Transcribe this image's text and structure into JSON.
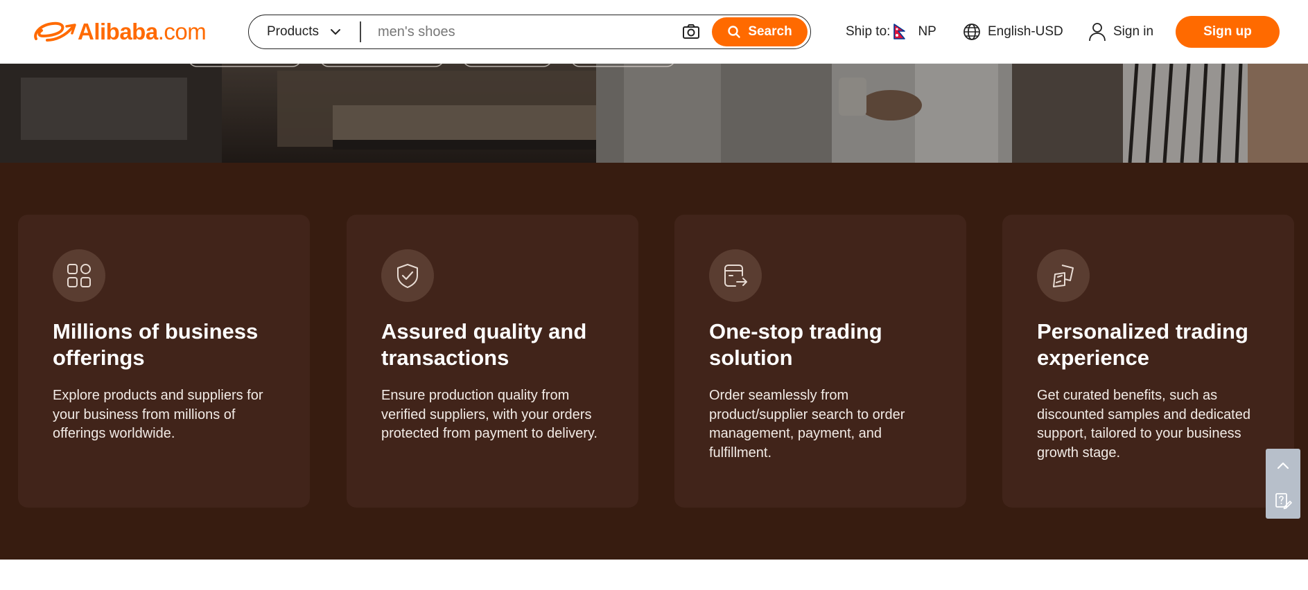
{
  "header": {
    "logo_brand": "Alibaba",
    "logo_suffix": ".com",
    "search": {
      "category": "Products",
      "placeholder": "men's shoes",
      "value": "",
      "button_label": "Search"
    },
    "ship_to": {
      "label": "Ship to:",
      "country": "NP"
    },
    "language": "English-USD",
    "sign_in": "Sign in",
    "sign_up": "Sign up"
  },
  "features": [
    {
      "icon": "grid-apps-icon",
      "title": "Millions of business offerings",
      "description": "Explore products and suppliers for your business from millions of offerings worldwide."
    },
    {
      "icon": "shield-check-icon",
      "title": "Assured quality and transactions",
      "description": "Ensure production quality from verified suppliers, with your orders protected from payment to delivery."
    },
    {
      "icon": "order-transfer-icon",
      "title": "One-stop trading solution",
      "description": "Order seamlessly from product/supplier search to order management, payment, and fulfillment."
    },
    {
      "icon": "personalized-cubes-icon",
      "title": "Personalized trading experience",
      "description": "Get curated benefits, such as discounted samples and dedicated support, tailored to your business growth stage."
    }
  ],
  "side_tools": [
    "back-to-top-icon",
    "feedback-icon"
  ],
  "colors": {
    "brand_orange": "#ff6a00",
    "section_bg": "#371c10",
    "card_bg": "#41241a",
    "icon_circle": "#5a3d31"
  }
}
